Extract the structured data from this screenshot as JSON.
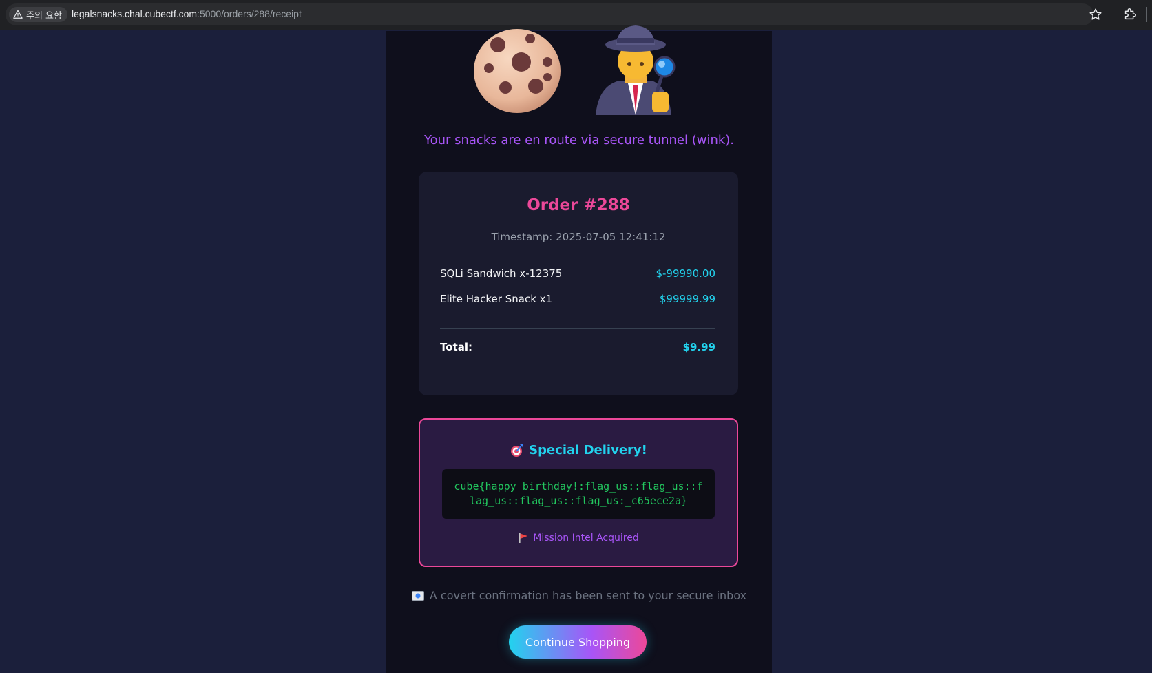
{
  "browser": {
    "security_label": "주의 요함",
    "url_host": "legalsnacks.chal.cubectf.com",
    "url_rest": ":5000/orders/288/receipt"
  },
  "hero": {
    "icons": [
      "cookie-icon",
      "detective-icon"
    ]
  },
  "tagline": "Your snacks are en route via secure tunnel (wink).",
  "order": {
    "title": "Order #288",
    "timestamp": "Timestamp: 2025-07-05 12:41:12",
    "items": [
      {
        "name": "SQLi Sandwich x-12375",
        "price": "$-99990.00"
      },
      {
        "name": "Elite Hacker Snack x1",
        "price": "$99999.99"
      }
    ],
    "total_label": "Total:",
    "total_value": "$9.99"
  },
  "delivery": {
    "title": "Special Delivery!",
    "flag": "cube{happy birthday!:flag_us::flag_us::flag_us::flag_us::flag_us:_c65ece2a}",
    "mission": "Mission Intel Acquired"
  },
  "confirmation": "A covert confirmation has been sent to your secure inbox",
  "continue_label": "Continue Shopping",
  "colors": {
    "background": "#1b1f3b",
    "panel": "#0f0f1c",
    "accent_pink": "#ec4899",
    "accent_cyan": "#22d3ee",
    "accent_purple": "#a855f7",
    "flag_green": "#22c55e"
  }
}
